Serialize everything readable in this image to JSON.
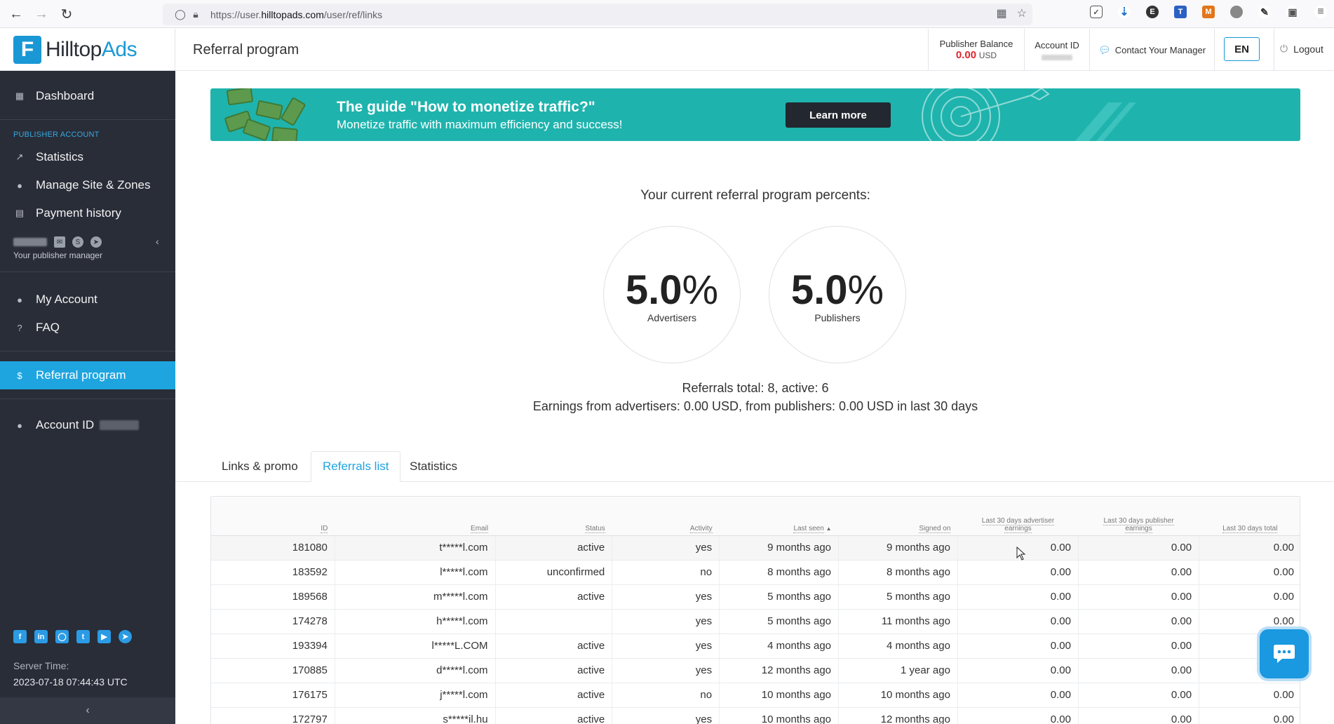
{
  "browser": {
    "url_prefix": "https://user.",
    "url_domain": "hilltopads.com",
    "url_path": "/user/ref/links"
  },
  "header": {
    "logo_text_a": "Hilltop",
    "logo_text_b": "Ads",
    "page_title": "Referral program",
    "balance_label": "Publisher Balance",
    "balance_value": "0.00",
    "balance_currency": "USD",
    "account_id_label": "Account ID",
    "contact_manager": "Contact Your Manager",
    "lang": "EN",
    "logout": "Logout"
  },
  "sidebar": {
    "dashboard": "Dashboard",
    "section_label": "PUBLISHER ACCOUNT",
    "statistics": "Statistics",
    "manage_sites": "Manage Site & Zones",
    "payment_history": "Payment history",
    "manager_caption": "Your publisher manager",
    "my_account": "My Account",
    "faq": "FAQ",
    "referral_program": "Referral program",
    "account_id": "Account ID",
    "server_time_label": "Server Time:",
    "server_time": "2023-07-18 07:44:43 UTC"
  },
  "banner": {
    "title": "The guide \"How to monetize traffic?\"",
    "subtitle": "Monetize traffic with maximum efficiency and success!",
    "button": "Learn more"
  },
  "referral": {
    "percents_title": "Your current referral program percents:",
    "advertisers_value": "5.0",
    "advertisers_label": "Advertisers",
    "publishers_value": "5.0",
    "publishers_label": "Publishers",
    "percent_sign": "%",
    "totals": "Referrals total: 8, active: 6",
    "earnings": "Earnings from advertisers: 0.00 USD, from publishers: 0.00 USD in last 30 days"
  },
  "tabs": [
    "Links & promo",
    "Referrals list",
    "Statistics"
  ],
  "table": {
    "headers": {
      "id": "ID",
      "email": "Email",
      "status": "Status",
      "activity": "Activity",
      "last_seen": "Last seen",
      "signed_on": "Signed on",
      "adv_earnings_1": "Last 30 days advertiser",
      "adv_earnings_2": "earnings",
      "pub_earnings_1": "Last 30 days publisher",
      "pub_earnings_2": "earnings",
      "total": "Last 30 days total"
    },
    "rows": [
      {
        "id": "181080",
        "email": "t*****l.com",
        "status": "active",
        "activity": "yes",
        "last_seen": "9 months ago",
        "signed_on": "9 months ago",
        "adv": "0.00",
        "pub": "0.00",
        "total": "0.00"
      },
      {
        "id": "183592",
        "email": "l*****l.com",
        "status": "unconfirmed",
        "activity": "no",
        "last_seen": "8 months ago",
        "signed_on": "8 months ago",
        "adv": "0.00",
        "pub": "0.00",
        "total": "0.00"
      },
      {
        "id": "189568",
        "email": "m*****l.com",
        "status": "active",
        "activity": "yes",
        "last_seen": "5 months ago",
        "signed_on": "5 months ago",
        "adv": "0.00",
        "pub": "0.00",
        "total": "0.00"
      },
      {
        "id": "174278",
        "email": "h*****l.com",
        "status": "",
        "activity": "yes",
        "last_seen": "5 months ago",
        "signed_on": "11 months ago",
        "adv": "0.00",
        "pub": "0.00",
        "total": "0.00"
      },
      {
        "id": "193394",
        "email": "l*****L.COM",
        "status": "active",
        "activity": "yes",
        "last_seen": "4 months ago",
        "signed_on": "4 months ago",
        "adv": "0.00",
        "pub": "0.00",
        "total": ""
      },
      {
        "id": "170885",
        "email": "d*****l.com",
        "status": "active",
        "activity": "yes",
        "last_seen": "12 months ago",
        "signed_on": "1 year ago",
        "adv": "0.00",
        "pub": "0.00",
        "total": ""
      },
      {
        "id": "176175",
        "email": "j*****l.com",
        "status": "active",
        "activity": "no",
        "last_seen": "10 months ago",
        "signed_on": "10 months ago",
        "adv": "0.00",
        "pub": "0.00",
        "total": "0.00"
      },
      {
        "id": "172797",
        "email": "s*****il.hu",
        "status": "active",
        "activity": "yes",
        "last_seen": "10 months ago",
        "signed_on": "12 months ago",
        "adv": "0.00",
        "pub": "0.00",
        "total": "0.00"
      }
    ]
  },
  "colors": {
    "accent": "#1ea5e0",
    "sidebar_bg": "#292d38",
    "banner_bg": "#1fb3ad",
    "balance_red": "#e0262c"
  }
}
